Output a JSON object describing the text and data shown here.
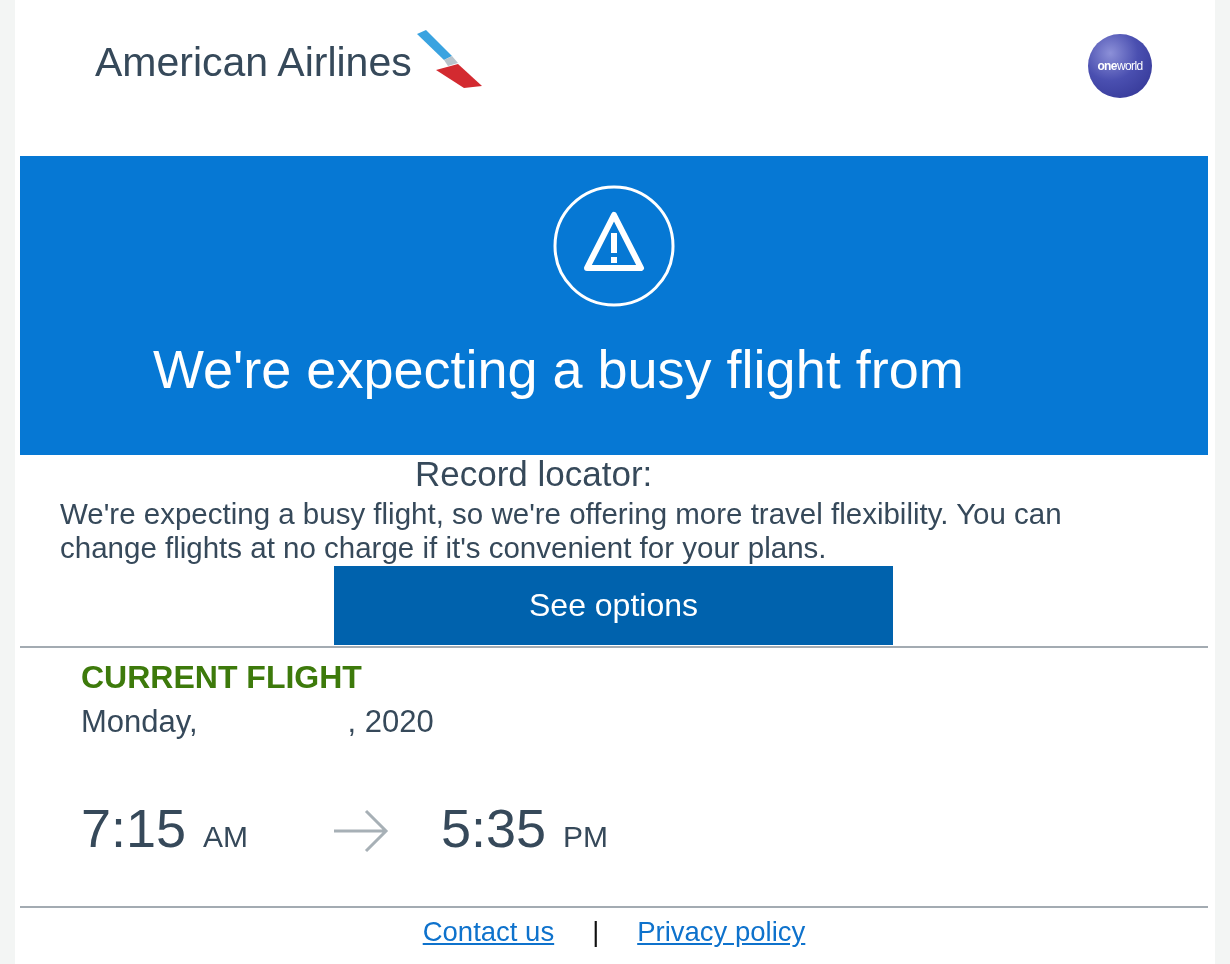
{
  "header": {
    "brand": "American Airlines",
    "alliance": "**one**world"
  },
  "alert": {
    "heading": "We're expecting a busy flight from"
  },
  "record_locator": "Record locator:",
  "message": "We're expecting a busy flight, so we're offering more travel flexibility. You can change flights at no charge if it's convenient for your plans.",
  "button": "See options",
  "current_flight": {
    "title": "CURRENT FLIGHT",
    "date_start": "Monday,",
    "date_end": ", 2020",
    "departure": {
      "time": "7:15",
      "period": "AM"
    },
    "arrival": {
      "time": "5:35",
      "period": "PM"
    }
  },
  "footer": {
    "links": [
      "Contact us",
      "Privacy policy"
    ],
    "separator": "|"
  }
}
